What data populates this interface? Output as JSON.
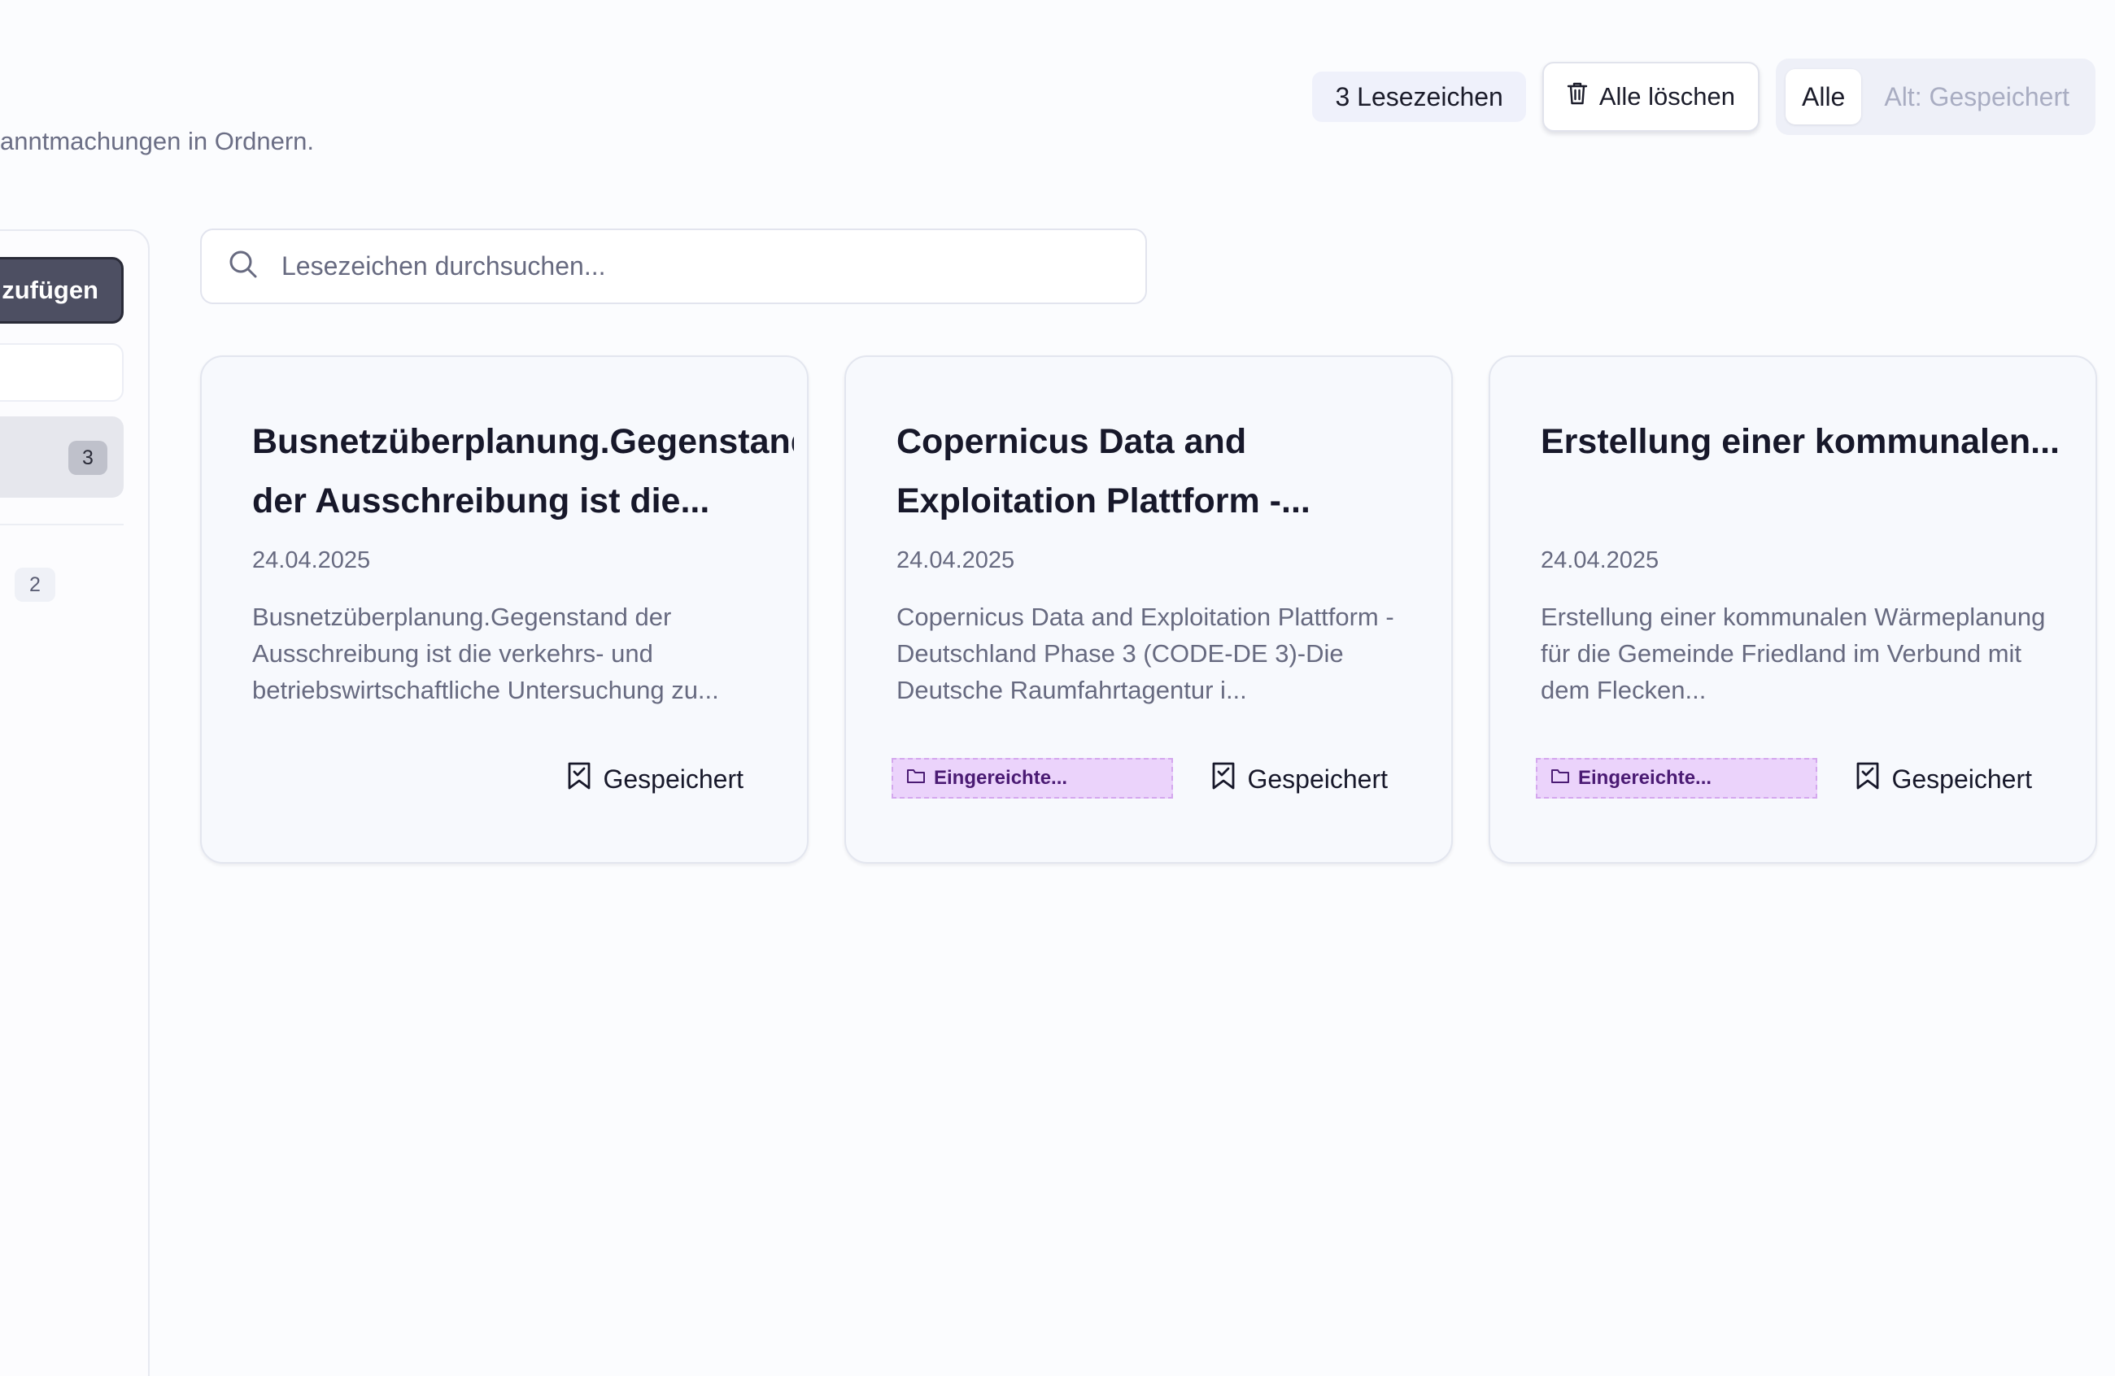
{
  "header": {
    "subtitle": "anntmachungen in Ordnern."
  },
  "toolbar": {
    "bookmark_count": "3 Lesezeichen",
    "clear_all_label": "Alle löschen",
    "filter_all": "Alle",
    "filter_saved": "Alt: Gespeichert"
  },
  "sidebar": {
    "add_label": "zufügen",
    "active_count": "3",
    "second_count": "2"
  },
  "search": {
    "placeholder": "Lesezeichen durchsuchen..."
  },
  "cards": [
    {
      "title": "Busnetzüberplanung.Gegenstand der Ausschreibung ist die...",
      "date": "24.04.2025",
      "description": "Busnetzüberplanung.Gegenstand der Ausschreibung ist die verkehrs- und betriebswirtschaftliche Untersuchung zu...",
      "folder": "",
      "saved_label": "Gespeichert"
    },
    {
      "title": "Copernicus Data and Exploitation Plattform -...",
      "date": "24.04.2025",
      "description": "Copernicus Data and Exploitation Plattform - Deutschland Phase 3 (CODE-DE 3)-Die Deutsche Raumfahrtagentur i...",
      "folder": "Eingereichte...",
      "saved_label": "Gespeichert"
    },
    {
      "title": "Erstellung einer kommunalen...",
      "date": "24.04.2025",
      "description": "Erstellung einer kommunalen Wärmeplanung für die Gemeinde Friedland im Verbund mit dem Flecken...",
      "folder": "Eingereichte...",
      "saved_label": "Gespeichert"
    }
  ],
  "icons": {
    "clear": "trash-icon",
    "search": "search-icon",
    "folder": "folder-icon",
    "saved": "bookmark-check-icon"
  },
  "colors": {
    "background": "#fbfcfe",
    "card": "#f7f9fd",
    "folder_tag_bg": "#ebd3fb",
    "folder_tag_text": "#4a1a73",
    "muted_text": "#676a80",
    "primary_dark": "#4d4f62"
  }
}
